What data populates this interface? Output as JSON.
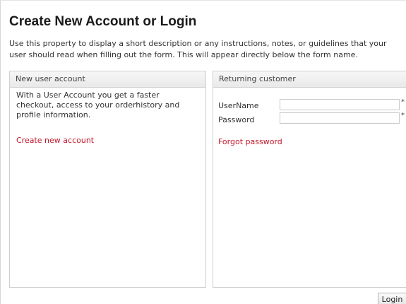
{
  "page": {
    "title": "Create New Account or Login",
    "description": "Use this property to display a short description or any instructions, notes, or guidelines that your user should read when filling out the form. This will appear directly below the form name."
  },
  "new_user": {
    "header": "New user account",
    "text": "With a User Account you get a faster checkout, access to your orderhistory and profile information.",
    "create_link": "Create new account"
  },
  "returning": {
    "header": "Returning customer",
    "username_label": "UserName",
    "username_value": "",
    "password_label": "Password",
    "password_value": "",
    "required_mark": "*",
    "forgot_link": "Forgot password"
  },
  "actions": {
    "login_label": "Login"
  },
  "colors": {
    "link": "#c0182a",
    "border": "#cfcfcf",
    "header_bg": "#efefef"
  }
}
